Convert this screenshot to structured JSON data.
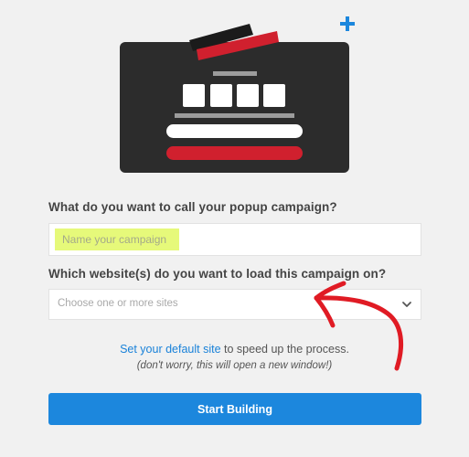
{
  "form": {
    "name_label": "What do you want to call your popup campaign?",
    "name_placeholder": "Name your campaign",
    "site_label": "Which website(s) do you want to load this campaign on?",
    "site_placeholder": "Choose one or more sites"
  },
  "helper": {
    "link_text": "Set your default site",
    "text_after_link": " to speed up the process.",
    "note": "(don't worry, this will open a new window!)"
  },
  "actions": {
    "start_label": "Start Building"
  },
  "colors": {
    "accent": "#1c87dd",
    "highlight": "#e6f97a",
    "annotation": "#e01b24",
    "illustration_bg": "#2c2c2c",
    "illustration_red": "#d0202e"
  },
  "icons": {
    "add": "plus-icon",
    "dropdown": "chevron-down-icon"
  }
}
